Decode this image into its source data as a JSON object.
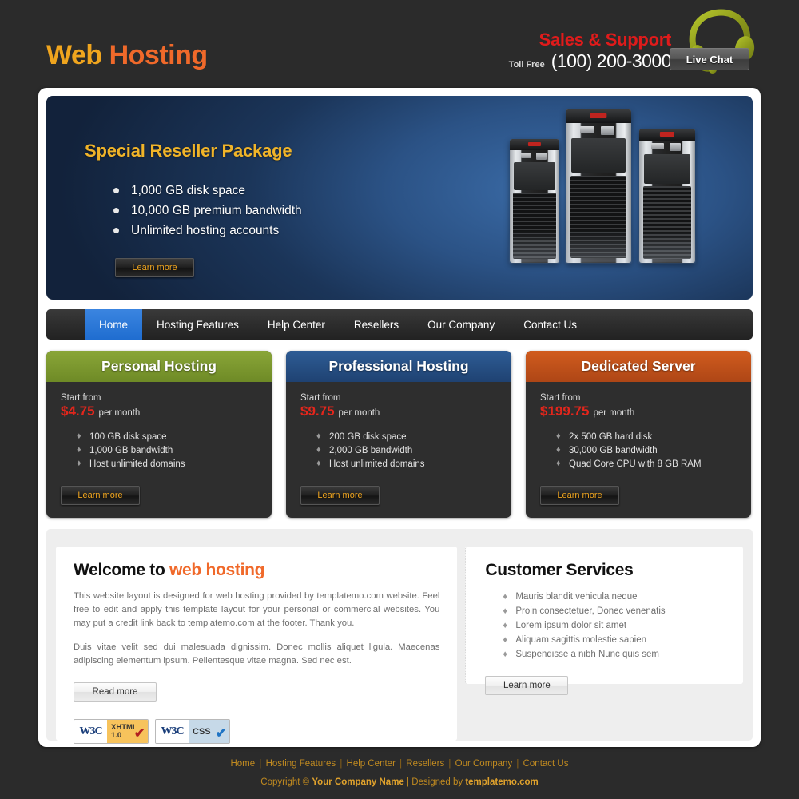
{
  "header": {
    "logo_part1": "Web",
    "logo_part2": "Hosting",
    "sales_label": "Sales & Support",
    "toll_free_label": "Toll Free",
    "phone": "(100) 200-3000",
    "live_chat_label": "Live Chat"
  },
  "banner": {
    "title": "Special Reseller Package",
    "features": [
      "1,000 GB disk space",
      "10,000 GB premium bandwidth",
      "Unlimited hosting accounts"
    ],
    "button_label": "Learn more"
  },
  "nav": {
    "items": [
      {
        "label": "Home",
        "active": true
      },
      {
        "label": "Hosting Features",
        "active": false
      },
      {
        "label": "Help Center",
        "active": false
      },
      {
        "label": "Resellers",
        "active": false
      },
      {
        "label": "Our Company",
        "active": false
      },
      {
        "label": "Contact Us",
        "active": false
      }
    ]
  },
  "plans": [
    {
      "title": "Personal Hosting",
      "header_color": "#7a9430",
      "start_from": "Start from",
      "price": "$4.75",
      "per_month": "per month",
      "features": [
        "100 GB disk space",
        "1,000 GB bandwidth",
        "Host unlimited domains"
      ],
      "button_label": "Learn more"
    },
    {
      "title": "Professional Hosting",
      "header_color": "#274f81",
      "start_from": "Start from",
      "price": "$9.75",
      "per_month": "per month",
      "features": [
        "200 GB disk space",
        "2,000 GB bandwidth",
        "Host unlimited domains"
      ],
      "button_label": "Learn more"
    },
    {
      "title": "Dedicated Server",
      "header_color": "#c1521b",
      "start_from": "Start from",
      "price": "$199.75",
      "per_month": "per month",
      "features": [
        "2x 500 GB hard disk",
        "30,000 GB bandwidth",
        "Quad Core CPU with 8 GB RAM"
      ],
      "button_label": "Learn more"
    }
  ],
  "welcome": {
    "heading_part1": "Welcome to ",
    "heading_accent": "web hosting",
    "paragraph1": "This website layout is designed for web hosting provided by templatemo.com website. Feel free to edit and apply this template layout for your personal or commercial websites. You may put a credit link back to templatemo.com at the footer. Thank you.",
    "paragraph2": "Duis vitae velit sed dui malesuada dignissim. Donec mollis aliquet ligula. Maecenas adipiscing elementum ipsum. Pellentesque vitae magna. Sed nec est.",
    "button_label": "Read more",
    "badges": [
      {
        "org": "W3C",
        "line1": "XHTML",
        "line2": "1.0",
        "check": "✔"
      },
      {
        "org": "W3C",
        "line1": "CSS",
        "line2": "",
        "check": "✔"
      }
    ]
  },
  "customer_services": {
    "heading": "Customer Services",
    "items": [
      "Mauris blandit vehicula neque",
      "Proin consectetuer, Donec venenatis",
      "Lorem ipsum dolor sit amet",
      "Aliquam sagittis molestie sapien",
      "Suspendisse a nibh Nunc quis sem"
    ],
    "button_label": "Learn more"
  },
  "footer": {
    "links": [
      "Home",
      "Hosting Features",
      "Help Center",
      "Resellers",
      "Our Company",
      "Contact Us"
    ],
    "copyright_prefix": "Copyright © ",
    "company": "Your Company Name",
    "designed_by_prefix": " | Designed by ",
    "designer": "templatemo.com"
  },
  "colors": {
    "page_bg": "#2b2b2b",
    "logo_gold": "#f0a51e",
    "logo_orange": "#f0692a",
    "sales_red": "#e01b1b",
    "nav_active_blue": "#2f7ada",
    "price_red": "#e2261c",
    "footer_gold": "#c08a20"
  }
}
